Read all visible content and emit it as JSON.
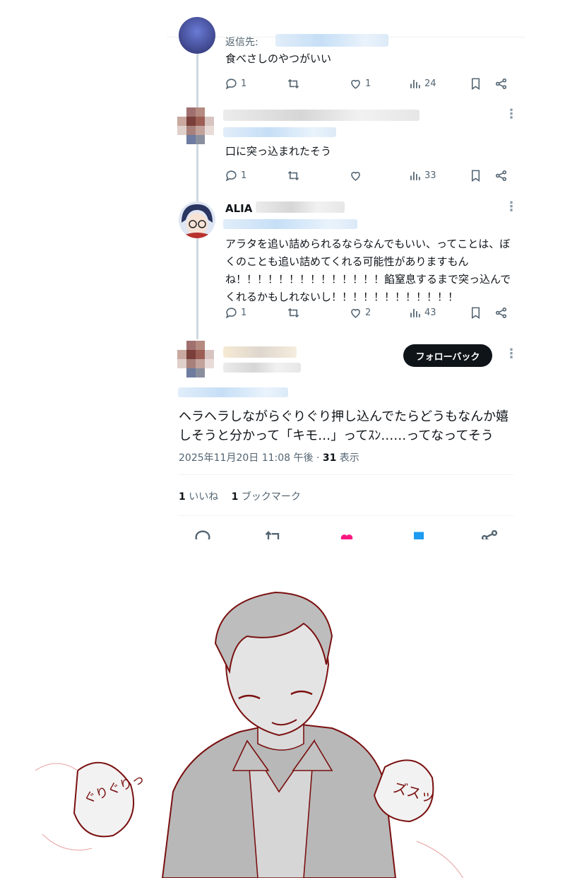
{
  "replies": [
    {
      "reply_to_label": "返信先:",
      "text": "食べさしのやつがいい",
      "stats": {
        "replies": "1",
        "retweets": "",
        "likes": "1",
        "views": "24"
      }
    },
    {
      "text": "口に突っ込まれたそう",
      "stats": {
        "replies": "1",
        "retweets": "",
        "likes": "",
        "views": "33"
      }
    },
    {
      "name": "ALIA",
      "text": "アラタを追い詰められるならなんでもいい、ってことは、ぼくのことも追い詰めてくれる可能性がありますもんね！！！！！！！！！！！！！！餡窒息するまで突っ込んでくれるかもしれないし！！！！！！！！！！！！",
      "stats": {
        "replies": "1",
        "retweets": "",
        "likes": "2",
        "views": "43"
      }
    }
  ],
  "main_tweet": {
    "follow_button": "フォローバック",
    "text": "ヘラヘラしながらぐりぐり押し込んでたらどうもなんか嬉しそうと分かって「キモ…」ってｽﾝ……ってなってそう",
    "datetime": "2025年11月20日 11:08 午後",
    "separator": " · ",
    "views_count": "31",
    "views_label": " 表示",
    "likes_count": "1",
    "likes_label": " いいね",
    "bookmarks_count": "1",
    "bookmarks_label": " ブックマーク"
  },
  "sketch": {
    "left_bubble": "ぐりぐりっ",
    "right_bubble": "ズスッ"
  },
  "colors": {
    "like_active": "#f91880",
    "bookmark_active": "#1d9bf0",
    "line_art": "#7a1010"
  }
}
